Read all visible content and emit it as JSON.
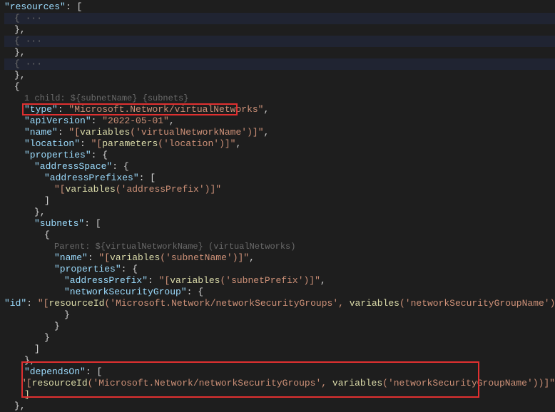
{
  "resourcesKey": "\"resources\"",
  "folded": "{ ··· ",
  "childHint": "1 child: ${subnetName} {subnets}",
  "parentHint": "Parent: ${virtualNetworkName} (virtualNetworks)",
  "kv": {
    "typeKey": "\"type\"",
    "typeVal": "\"Microsoft.Network/virtualNetworks\"",
    "apiVersionKey": "\"apiVersion\"",
    "apiVersionVal": "\"2022-05-01\"",
    "nameKey": "\"name\"",
    "nameVal1": "\"[",
    "variablesFn": "variables",
    "vnetNameArg": "'virtualNetworkName'",
    "nameVal2": ")]\"",
    "locationKey": "\"location\"",
    "paramsFn": "parameters",
    "locationArg": "'location'",
    "propsKey": "\"properties\"",
    "addrSpaceKey": "\"addressSpace\"",
    "addrPrefixesKey": "\"addressPrefixes\"",
    "addrPrefixArg": "'addressPrefix'",
    "subnetsKey": "\"subnets\"",
    "subnetNameArg": "'subnetName'",
    "addrPrefixKey": "\"addressPrefix\"",
    "subnetPrefixArg": "'subnetPrefix'",
    "nsgKey": "\"networkSecurityGroup\"",
    "idKey": "\"id\"",
    "resourceIdFn": "resourceId",
    "nsgType": "'Microsoft.Network/networkSecurityGroups'",
    "nsgNameArg": "'networkSecurityGroupName'",
    "dependsOnKey": "\"dependsOn\""
  },
  "punct": {
    "colon": ": ",
    "comma": ",",
    "lbrace": "{",
    "rbrace": "}",
    "lbracket": "[",
    "rbracket": "]",
    "lparen": "(",
    "rparen": ")",
    "commaSp": ", ",
    "bracketOpen": "\"[",
    "bracketClose": ")]\"",
    "space": " "
  }
}
